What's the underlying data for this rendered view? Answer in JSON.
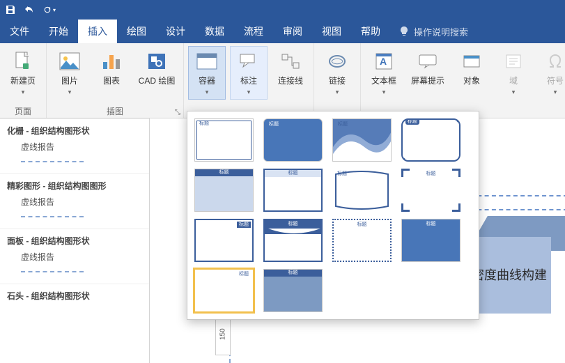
{
  "titlebar": {
    "icons": [
      "save",
      "undo",
      "redo"
    ]
  },
  "tabs": {
    "items": [
      {
        "label": "文件"
      },
      {
        "label": "开始"
      },
      {
        "label": "插入",
        "active": true
      },
      {
        "label": "绘图"
      },
      {
        "label": "设计"
      },
      {
        "label": "数据"
      },
      {
        "label": "流程"
      },
      {
        "label": "审阅"
      },
      {
        "label": "视图"
      },
      {
        "label": "帮助"
      }
    ],
    "tellme": "操作说明搜索"
  },
  "ribbon": {
    "groups": [
      {
        "label": "页面",
        "buttons": [
          {
            "label": "新建页",
            "caret": true
          }
        ]
      },
      {
        "label": "插图",
        "buttons": [
          {
            "label": "图片",
            "caret": true
          },
          {
            "label": "图表"
          },
          {
            "label": "CAD 绘图"
          }
        ],
        "launcher": true
      },
      {
        "label": "",
        "buttons": [
          {
            "label": "容器",
            "caret": true,
            "active": true
          },
          {
            "label": "标注",
            "caret": true
          },
          {
            "label": "连接线"
          }
        ]
      },
      {
        "label": "",
        "buttons": [
          {
            "label": "链接",
            "caret": true
          }
        ]
      },
      {
        "label": "",
        "buttons": [
          {
            "label": "文本框",
            "caret": true
          },
          {
            "label": "屏幕提示"
          },
          {
            "label": "对象"
          },
          {
            "label": "域",
            "caret": true,
            "disabled": true
          },
          {
            "label": "符号",
            "caret": true,
            "disabled": true
          }
        ]
      }
    ]
  },
  "shapes": {
    "cats": [
      {
        "title": "化栅 - 组织结构图形状",
        "item": "虚线报告"
      },
      {
        "title": "精彩图形 - 组织结构图图形",
        "item": "虚线报告"
      },
      {
        "title": "面板 - 组织结构图形状",
        "item": "虚线报告"
      },
      {
        "title": "石头 - 组织结构图形状",
        "item": ""
      }
    ]
  },
  "gallery": {
    "tag": "标题"
  },
  "canvas": {
    "cube_text": "密度曲线构建",
    "ruler": "150"
  }
}
